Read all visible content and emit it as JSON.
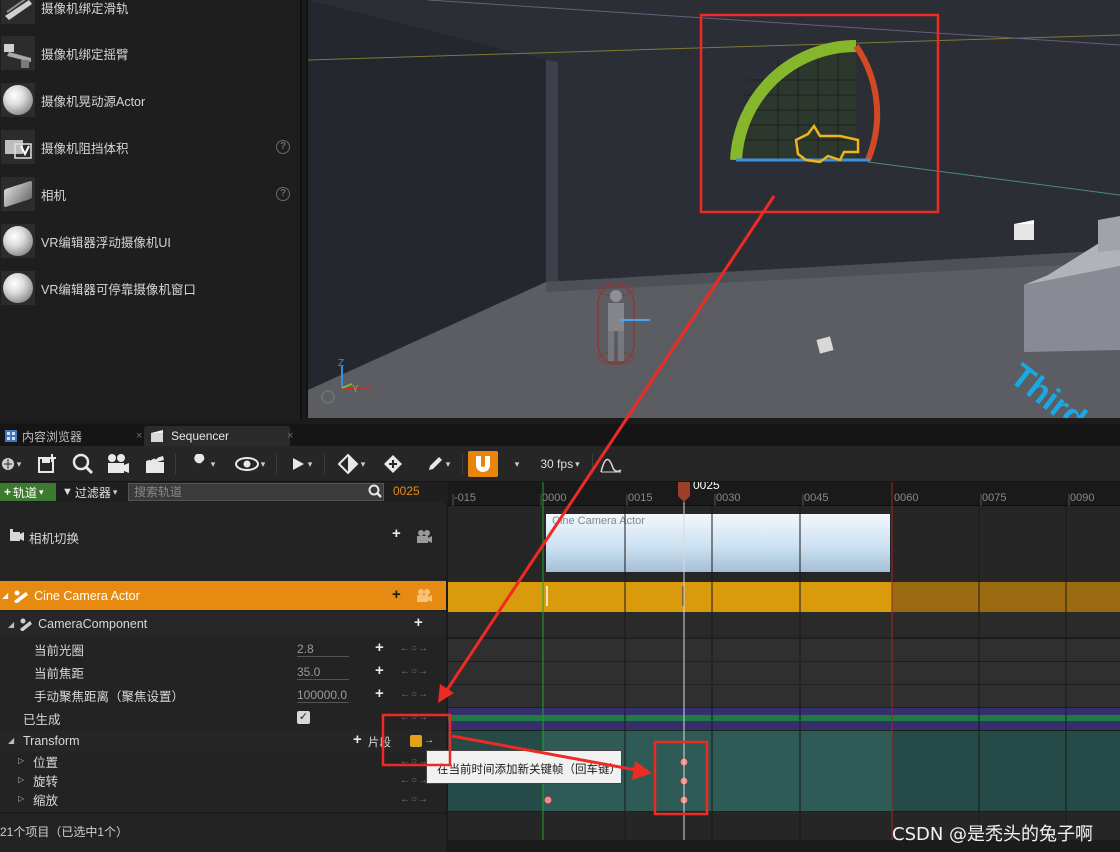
{
  "place_actors": {
    "items": [
      {
        "label": "摄像机绑定滑轨",
        "icon": "camera-rail-icon",
        "help": false
      },
      {
        "label": "摄像机绑定摇臂",
        "icon": "camera-crane-icon",
        "help": false
      },
      {
        "label": "摄像机晃动源Actor",
        "icon": "sphere-icon",
        "help": false
      },
      {
        "label": "摄像机阻挡体积",
        "icon": "camera-blocking-volume-icon",
        "help": true
      },
      {
        "label": "相机",
        "icon": "camera-icon",
        "help": true
      },
      {
        "label": "VR编辑器浮动摄像机UI",
        "icon": "sphere-icon",
        "help": false
      },
      {
        "label": "VR编辑器可停靠摄像机窗口",
        "icon": "sphere-icon",
        "help": false
      }
    ],
    "help_glyph": "?"
  },
  "viewport": {
    "axis_labels": {
      "z": "Z",
      "y": "Y",
      "x": "X"
    },
    "floor_text": "Third"
  },
  "tabs": [
    {
      "label": "内容浏览器",
      "close": "×",
      "active": false
    },
    {
      "label": "Sequencer",
      "close": "×",
      "active": true
    }
  ],
  "toolbar": {
    "fps": "30 fps",
    "snap_active": true
  },
  "filter_row": {
    "add_track_label": "轨道",
    "filter_label": "过滤器",
    "search_placeholder": "搜索轨道",
    "current_frame": "0025"
  },
  "tracks": {
    "camera_cuts": "相机切换",
    "actor": "Cine Camera Actor",
    "component": "CameraComponent",
    "aperture_label": "当前光圈",
    "aperture_value": "2.8",
    "focal_label": "当前焦距",
    "focal_value": "35.0",
    "focus_label": "手动聚焦距离（聚焦设置）",
    "focus_value": "100000.0",
    "spawned_label": "已生成",
    "transform_label": "Transform",
    "section_label": "片段",
    "location_label": "位置",
    "rotation_label": "旋转",
    "scale_label": "缩放"
  },
  "timeline": {
    "playhead": "0025",
    "ticks": [
      "-015",
      "0000",
      "0015",
      "0030",
      "0045",
      "0060",
      "0075",
      "0090"
    ],
    "shot_label": "Cine Camera Actor"
  },
  "tooltip": "在当前时间添加新关键帧（回车键）",
  "status": "21个项目（已选中1个）",
  "watermark": "CSDN @是秃头的兔子啊",
  "colors": {
    "accent_orange": "#e7860a",
    "track_green": "#3c7a2f",
    "annotation_red": "#ee2a24"
  }
}
